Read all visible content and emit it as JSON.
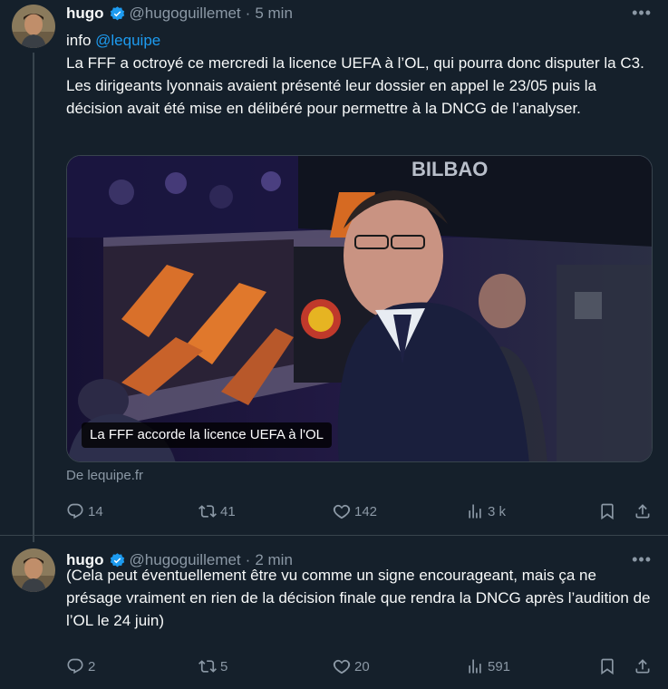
{
  "tweets": [
    {
      "author": {
        "name": "hugo",
        "handle": "@hugoguillemet",
        "time": "5 min",
        "verified": true
      },
      "text_prefix": "info ",
      "mention": "@lequipe",
      "body": "La FFF a octroyé ce mercredi la licence UEFA à l’OL, qui pourra donc disputer la C3. Les dirigeants lyonnais avaient présenté leur dossier en appel le 23/05 puis la décision avait été mise en délibéré pour permettre à la DNCG de l’analyser.",
      "card": {
        "caption": "La FFF accorde la licence UEFA à l'OL",
        "source": "De lequipe.fr",
        "photo_text": "BILBAO"
      },
      "stats": {
        "replies": "14",
        "retweets": "41",
        "likes": "142",
        "views": "3 k"
      }
    },
    {
      "author": {
        "name": "hugo",
        "handle": "@hugoguillemet",
        "time": "2 min",
        "verified": true
      },
      "body": "(Cela peut éventuellement être vu comme un signe encourageant, mais ça ne présage vraiment en rien de la décision finale que rendra la DNCG après l’audition de l’OL le 24 juin)",
      "stats": {
        "replies": "2",
        "retweets": "5",
        "likes": "20",
        "views": "591"
      }
    }
  ],
  "ui": {
    "separator": "·",
    "more_glyph": "•••"
  },
  "colors": {
    "background": "#15202b",
    "muted": "#8b98a5",
    "accent": "#1d9bf0",
    "border": "#38444d"
  },
  "icons": [
    "reply-icon",
    "retweet-icon",
    "like-icon",
    "views-icon",
    "bookmark-icon",
    "share-icon",
    "verified-badge-icon",
    "more-icon"
  ]
}
